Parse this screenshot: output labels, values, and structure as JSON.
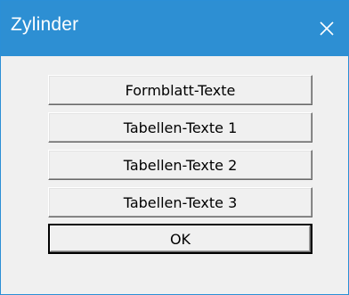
{
  "window": {
    "title": "Zylinder",
    "close_icon": "close-icon",
    "title_bar_color": "#2d8fd3"
  },
  "buttons": [
    {
      "label": "Formblatt-Texte"
    },
    {
      "label": "Tabellen-Texte 1"
    },
    {
      "label": "Tabellen-Texte 2"
    },
    {
      "label": "Tabellen-Texte 3"
    },
    {
      "label": "OK"
    }
  ]
}
